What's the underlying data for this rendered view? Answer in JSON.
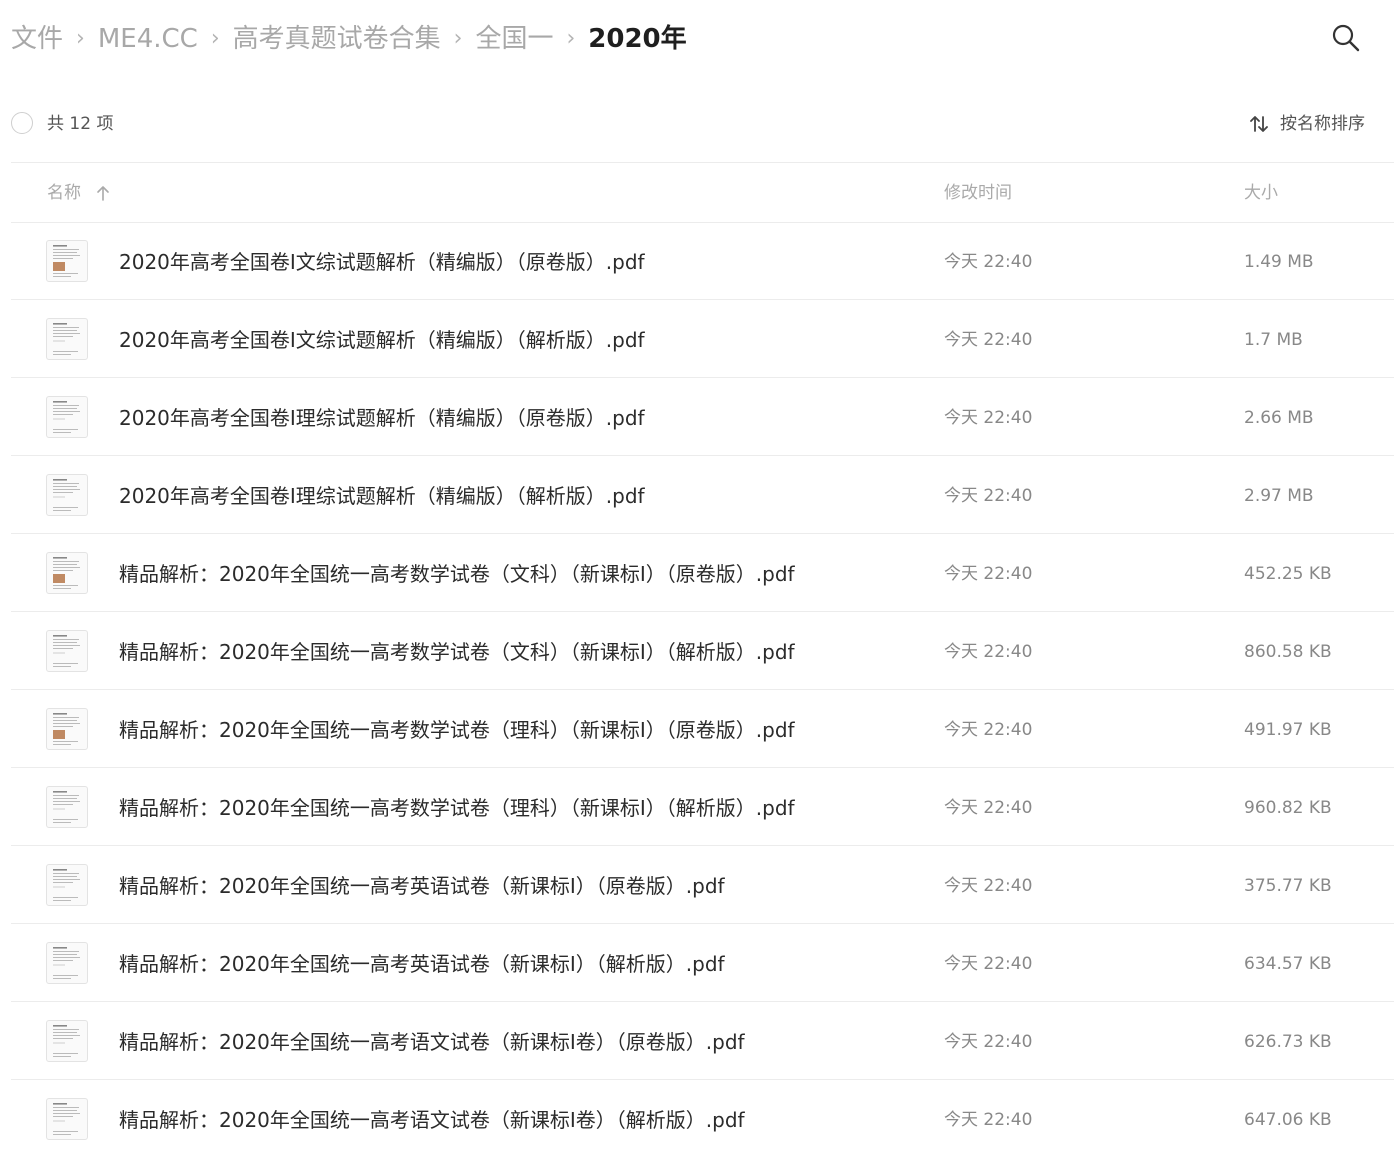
{
  "breadcrumb": {
    "items": [
      "文件",
      "ME4.CC",
      "高考真题试卷合集",
      "全国一",
      "2020年"
    ],
    "separator": "›"
  },
  "search": {
    "icon": "search-icon"
  },
  "toolbar": {
    "count_label": "共 12 项",
    "sort_label": "按名称排序",
    "sort_icon": "sort-arrows-icon"
  },
  "columns": {
    "name": "名称",
    "time": "修改时间",
    "size": "大小",
    "sort_direction_icon": "arrow-up-icon"
  },
  "files": [
    {
      "name": "2020年高考全国卷Ⅰ文综试题解析（精编版）（原卷版）.pdf",
      "time": "今天 22:40",
      "size": "1.49 MB",
      "thumb": "pdf-thumbnail-image"
    },
    {
      "name": "2020年高考全国卷Ⅰ文综试题解析（精编版）（解析版）.pdf",
      "time": "今天 22:40",
      "size": "1.7 MB",
      "thumb": "pdf-thumbnail"
    },
    {
      "name": "2020年高考全国卷Ⅰ理综试题解析（精编版）（原卷版）.pdf",
      "time": "今天 22:40",
      "size": "2.66 MB",
      "thumb": "pdf-thumbnail"
    },
    {
      "name": "2020年高考全国卷Ⅰ理综试题解析（精编版）（解析版）.pdf",
      "time": "今天 22:40",
      "size": "2.97 MB",
      "thumb": "pdf-thumbnail"
    },
    {
      "name": "精品解析：2020年全国统一高考数学试卷（文科）（新课标Ⅰ）（原卷版）.pdf",
      "time": "今天 22:40",
      "size": "452.25 KB",
      "thumb": "pdf-thumbnail-image"
    },
    {
      "name": "精品解析：2020年全国统一高考数学试卷（文科）（新课标Ⅰ）（解析版）.pdf",
      "time": "今天 22:40",
      "size": "860.58 KB",
      "thumb": "pdf-thumbnail"
    },
    {
      "name": "精品解析：2020年全国统一高考数学试卷（理科）（新课标Ⅰ）（原卷版）.pdf",
      "time": "今天 22:40",
      "size": "491.97 KB",
      "thumb": "pdf-thumbnail-image"
    },
    {
      "name": "精品解析：2020年全国统一高考数学试卷（理科）（新课标Ⅰ）（解析版）.pdf",
      "time": "今天 22:40",
      "size": "960.82 KB",
      "thumb": "pdf-thumbnail"
    },
    {
      "name": "精品解析：2020年全国统一高考英语试卷（新课标Ⅰ）（原卷版）.pdf",
      "time": "今天 22:40",
      "size": "375.77 KB",
      "thumb": "pdf-thumbnail"
    },
    {
      "name": "精品解析：2020年全国统一高考英语试卷（新课标Ⅰ）（解析版）.pdf",
      "time": "今天 22:40",
      "size": "634.57 KB",
      "thumb": "pdf-thumbnail"
    },
    {
      "name": "精品解析：2020年全国统一高考语文试卷（新课标Ⅰ卷）（原卷版）.pdf",
      "time": "今天 22:40",
      "size": "626.73 KB",
      "thumb": "pdf-thumbnail"
    },
    {
      "name": "精品解析：2020年全国统一高考语文试卷（新课标Ⅰ卷）（解析版）.pdf",
      "time": "今天 22:40",
      "size": "647.06 KB",
      "thumb": "pdf-thumbnail"
    }
  ]
}
